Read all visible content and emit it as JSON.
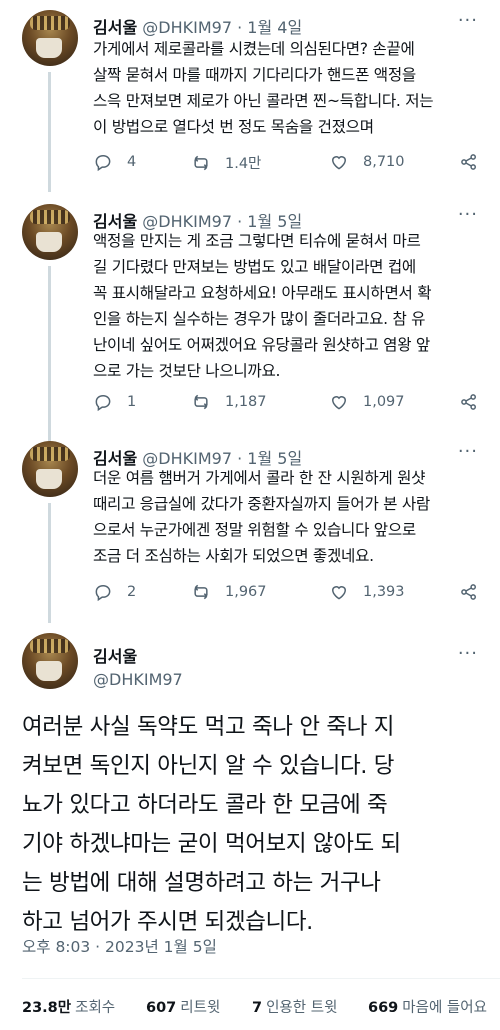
{
  "tweets": [
    {
      "name": "김서울",
      "handle": "@DHKIM97",
      "sep": "·",
      "date": "1월 4일",
      "text": "가게에서 제로콜라를 시켰는데 의심된다면? 손끝에\n살짝 묻혀서 마를 때까지 기다리다가 핸드폰 액정을\n스윽 만져보면 제로가 아닌 콜라면 찐~득합니다. 저는\n이 방법으로 열다섯 번 정도 목숨을 건졌으며",
      "replies": "4",
      "retweets": "1.4만",
      "likes": "8,710"
    },
    {
      "name": "김서울",
      "handle": "@DHKIM97",
      "sep": "·",
      "date": "1월 5일",
      "text": "액정을 만지는 게 조금 그렇다면 티슈에 묻혀서 마르\n길 기다렸다 만져보는 방법도 있고 배달이라면 컵에\n꼭 표시해달라고 요청하세요! 아무래도 표시하면서 확\n인을 하는지 실수하는 경우가 많이 줄더라고요. 참 유\n난이네 싶어도 어쩌겠어요 유당콜라 원샷하고 염왕 앞\n으로 가는 것보단 나으니까요.",
      "replies": "1",
      "retweets": "1,187",
      "likes": "1,097"
    },
    {
      "name": "김서울",
      "handle": "@DHKIM97",
      "sep": "·",
      "date": "1월 5일",
      "text": "더운 여름 햄버거 가게에서 콜라 한 잔 시원하게 원샷\n때리고 응급실에 갔다가 중환자실까지 들어가 본 사람\n으로서 누군가에겐 정말 위험할 수 있습니다 앞으로\n조금 더 조심하는 사회가 되었으면 좋겠네요.",
      "replies": "2",
      "retweets": "1,967",
      "likes": "1,393"
    }
  ],
  "main": {
    "name": "김서울",
    "handle": "@DHKIM97",
    "text": "여러분 사실 독약도 먹고 죽나 안 죽나 지\n켜보면 독인지 아닌지 알 수 있습니다. 당\n뇨가 있다고 하더라도 콜라 한 모금에 죽\n기야 하겠냐마는 굳이 먹어보지 않아도 되\n는 방법에 대해 설명하려고 하는 거구나\n하고 넘어가 주시면 되겠습니다.",
    "meta": "오후 8:03 · 2023년 1월 5일",
    "stats": [
      {
        "num": "23.8만",
        "label": "조회수"
      },
      {
        "num": "607",
        "label": "리트윗"
      },
      {
        "num": "7",
        "label": "인용한 트윗"
      },
      {
        "num": "669",
        "label": "마음에 들어요"
      }
    ]
  },
  "ui": {
    "more": "···"
  },
  "icons": {
    "reply": "reply-icon",
    "retweet": "retweet-icon",
    "like": "heart-icon",
    "share": "share-icon"
  },
  "colors": {
    "text": "#0f1419",
    "muted": "#536471",
    "thread_line": "#cfd9de"
  }
}
